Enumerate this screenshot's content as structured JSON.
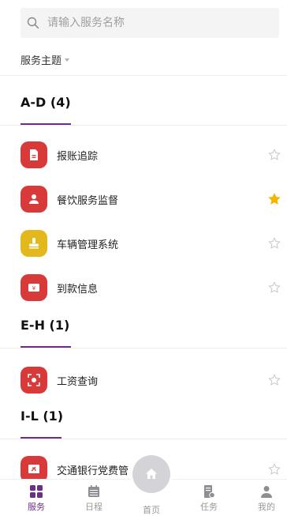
{
  "search": {
    "placeholder": "请输入服务名称"
  },
  "filter": {
    "label": "服务主题"
  },
  "sections": [
    {
      "title": "A-D (4)",
      "items": [
        {
          "label": "报账追踪",
          "icon": "document-icon",
          "color": "#d83a3a",
          "starred": false
        },
        {
          "label": "餐饮服务监督",
          "icon": "chef-icon",
          "color": "#d83a3a",
          "starred": true
        },
        {
          "label": "车辆管理系统",
          "icon": "stamp-icon",
          "color": "#e2b81c",
          "starred": false
        },
        {
          "label": "到款信息",
          "icon": "money-card-icon",
          "color": "#d83a3a",
          "starred": false
        }
      ]
    },
    {
      "title": "E-H (1)",
      "items": [
        {
          "label": "工资查询",
          "icon": "scan-icon",
          "color": "#d83a3a",
          "starred": false
        }
      ]
    },
    {
      "title": "I-L (1)",
      "items": [
        {
          "label": "交通银行党费管",
          "icon": "party-emblem-icon",
          "color": "#d83a3a",
          "starred": false
        }
      ]
    }
  ],
  "tabbar": {
    "tabs": [
      {
        "label": "服务",
        "icon": "grid-icon",
        "active": true
      },
      {
        "label": "日程",
        "icon": "calendar-icon",
        "active": false
      },
      {
        "label": "首页",
        "icon": "home-icon",
        "active": false
      },
      {
        "label": "任务",
        "icon": "task-icon",
        "active": false
      },
      {
        "label": "我的",
        "icon": "user-icon",
        "active": false
      }
    ]
  },
  "colors": {
    "accent": "#6b2f88",
    "star_active": "#f5b400",
    "star_inactive": "#c8c8c8",
    "icon_red": "#d83a3a",
    "icon_yellow": "#e2b81c"
  }
}
